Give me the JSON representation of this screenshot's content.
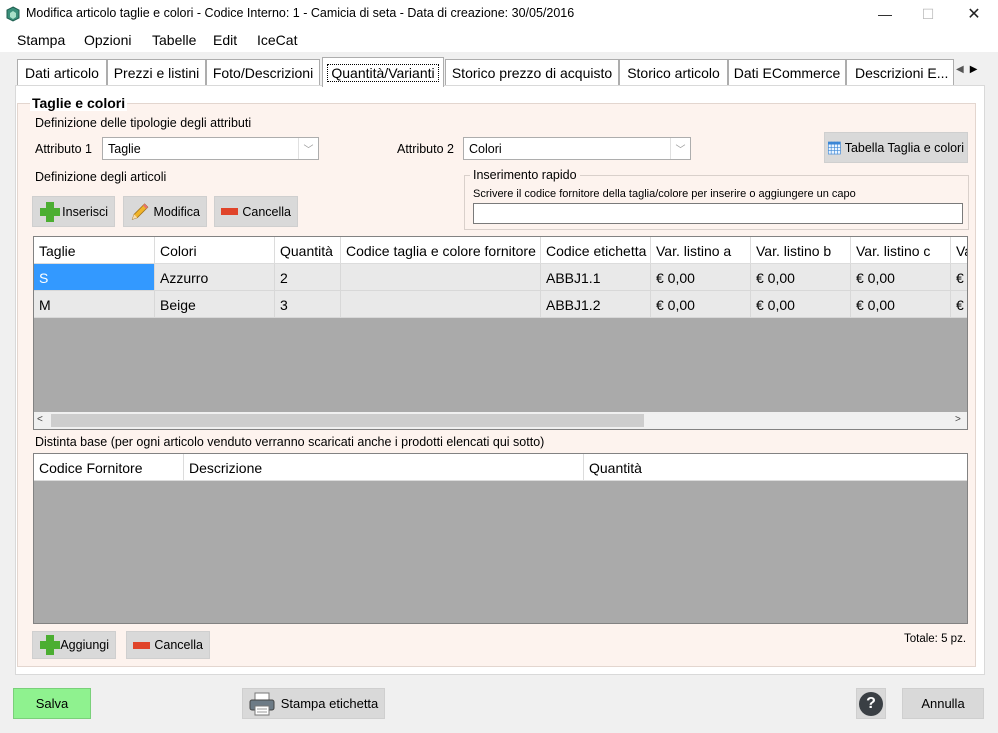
{
  "window": {
    "title": "Modifica articolo taglie e colori - Codice Interno: 1 - Camicia di seta - Data di creazione: 30/05/2016",
    "minimize": "—",
    "maximize": "☐",
    "close": "✕"
  },
  "menu": [
    "Stampa",
    "Opzioni",
    "Tabelle",
    "Edit",
    "IceCat"
  ],
  "tabs": [
    "Dati articolo",
    "Prezzi e listini",
    "Foto/Descrizioni",
    "Quantità/Varianti",
    "Storico prezzo di acquisto",
    "Storico articolo",
    "Dati ECommerce",
    "Descrizioni E..."
  ],
  "active_tab": "Quantità/Varianti",
  "section": {
    "title": "Taglie e colori",
    "def_attr_label": "Definizione delle tipologie degli attributi",
    "attr1_label": "Attributo 1",
    "attr1_value": "Taglie",
    "attr2_label": "Attributo 2",
    "attr2_value": "Colori",
    "table_button": "Tabella Taglia e colori",
    "def_articles_label": "Definizione degli articoli",
    "btn_insert": "Inserisci",
    "btn_edit": "Modifica",
    "btn_delete": "Cancella",
    "quick_title": "Inserimento rapido",
    "quick_hint": "Scrivere il codice fornitore della taglia/colore per inserire o aggiungere un capo",
    "quick_value": ""
  },
  "variants_table": {
    "columns": [
      "Taglie",
      "Colori",
      "Quantità",
      "Codice taglia e colore fornitore",
      "Codice etichetta",
      "Var. listino a",
      "Var. listino b",
      "Var. listino c",
      "Va"
    ],
    "rows": [
      [
        "S",
        "Azzurro",
        "2",
        "",
        "ABBJ1.1",
        "€ 0,00",
        "€ 0,00",
        "€ 0,00",
        "€"
      ],
      [
        "M",
        "Beige",
        "3",
        "",
        "ABBJ1.2",
        "€ 0,00",
        "€ 0,00",
        "€ 0,00",
        "€"
      ]
    ]
  },
  "bom": {
    "label": "Distinta base (per ogni articolo venduto verranno scaricati anche i prodotti elencati qui sotto)",
    "columns": [
      "Codice Fornitore",
      "Descrizione",
      "Quantità"
    ],
    "btn_add": "Aggiungi",
    "btn_delete": "Cancella",
    "total": "Totale: 5 pz."
  },
  "footer": {
    "save": "Salva",
    "print_label": "Stampa etichetta",
    "help": "?",
    "cancel": "Annulla"
  },
  "colors": {
    "save_bg": "#8ff28f",
    "selection": "#3399ff",
    "grid_empty": "#aaaaaa",
    "panel_bg": "#fdf3ee"
  }
}
